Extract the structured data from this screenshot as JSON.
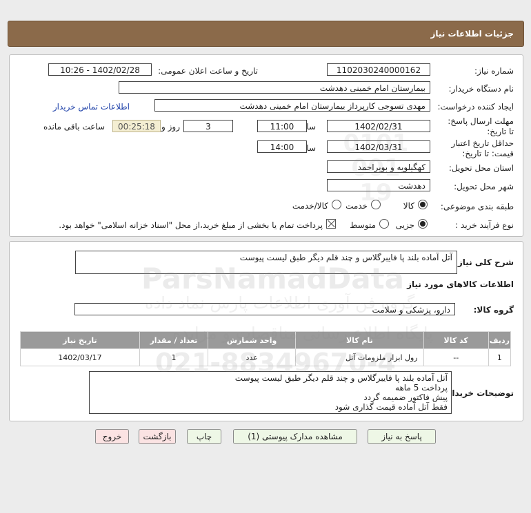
{
  "header": {
    "title": "جزئیات اطلاعات نیاز"
  },
  "labels": {
    "need_number": "شماره نیاز:",
    "announce_datetime": "تاریخ و ساعت اعلان عمومی:",
    "buyer_org": "نام دستگاه خریدار:",
    "requester": "ایجاد کننده درخواست:",
    "contact_link": "اطلاعات تماس خریدار",
    "reply_deadline": "مهلت ارسال پاسخ: تا تاریخ:",
    "time": "ساعت",
    "days_and": "روز و",
    "remaining": "ساعت باقی مانده",
    "validity": "حداقل تاریخ اعتبار قیمت: تا تاریخ:",
    "province": "استان محل تحویل:",
    "city": "شهر محل تحویل:",
    "category": "طبقه بندی موضوعی:",
    "purchase_type": "نوع فرآیند خرید :",
    "payment_note": "پرداخت تمام یا بخشی از مبلغ خرید،از محل \"اسناد خزانه اسلامی\" خواهد بود.",
    "general_desc": "شرح کلی نیاز:",
    "goods_info": "اطلاعات کالاهای مورد نیاز",
    "goods_group": "گروه کالا:",
    "buyer_notes": "توضیحات خریدار:"
  },
  "values": {
    "need_number": "1102030240000162",
    "announce_datetime": "1402/02/28 - 10:26",
    "buyer_org": "بیمارستان امام خمینی دهدشت",
    "requester": "مهدی تسوجی کارپرداز بیمارستان امام خمینی دهدشت",
    "reply_date": "1402/02/31",
    "reply_time": "11:00",
    "days": "3",
    "countdown": "00:25:18",
    "validity_date": "1402/03/31",
    "validity_time": "14:00",
    "province": "کهگیلویه و بویراحمد",
    "city": "دهدشت",
    "general_desc": "آتل آماده بلند پا فایبرگلاس و چند قلم دیگر طبق لیست پیوست",
    "goods_group": "دارو، پزشکی و سلامت",
    "buyer_notes": [
      "آتل آماده بلند پا فایبرگلاس و چند قلم دیگر طبق لیست پیوست",
      "پرداخت 5 ماهه",
      "پیش فاکتور ضمیمه گردد",
      "فقط آتل آماده قیمت گذاری شود"
    ]
  },
  "options": {
    "category": [
      {
        "label": "کالا",
        "selected": true
      },
      {
        "label": "خدمت",
        "selected": false
      },
      {
        "label": "کالا/خدمت",
        "selected": false
      }
    ],
    "purchase": [
      {
        "label": "جزیی",
        "selected": true
      },
      {
        "label": "متوسط",
        "selected": false
      }
    ]
  },
  "table": {
    "headers": [
      "ردیف",
      "کد کالا",
      "نام کالا",
      "واحد شمارش",
      "تعداد / مقدار",
      "تاریخ نیاز"
    ],
    "rows": [
      [
        "1",
        "--",
        "رول ابزار ملزومات آتل",
        "عدد",
        "1",
        "1402/03/17"
      ]
    ]
  },
  "buttons": {
    "reply": "پاسخ به نیاز",
    "attachments": "مشاهده مدارک پیوستی (1)",
    "print": "چاپ",
    "back": "بازگشت",
    "exit": "خروج"
  },
  "watermark": {
    "brand": "ParsNamadData",
    "line1": "پایگاه اطلاع رسانی مناقصات و مزایده",
    "line2": "گروه فن آوری اطلاعات پارس نماد داده",
    "phone": "021-88349670-4",
    "digits": "0101 001 19"
  }
}
